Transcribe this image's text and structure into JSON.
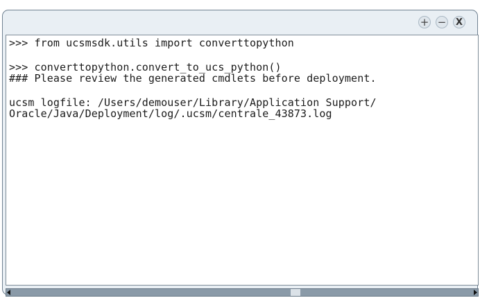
{
  "window": {
    "buttons": {
      "plus_label": "+",
      "minus_label": "−",
      "close_label": "X"
    }
  },
  "console": {
    "lines": [
      ">>> from ucsmsdk.utils import converttopython",
      ">>> converttopython.convert_to_ucs_python()",
      "### Please review the generated cmdlets before deployment.",
      "ucsm logfile: /Users/demouser/Library/Application Support/",
      "Oracle/Java/Deployment/log/.ucsm/centrale_43873.log"
    ]
  },
  "scrollbar": {
    "position_fraction": 0.6
  }
}
